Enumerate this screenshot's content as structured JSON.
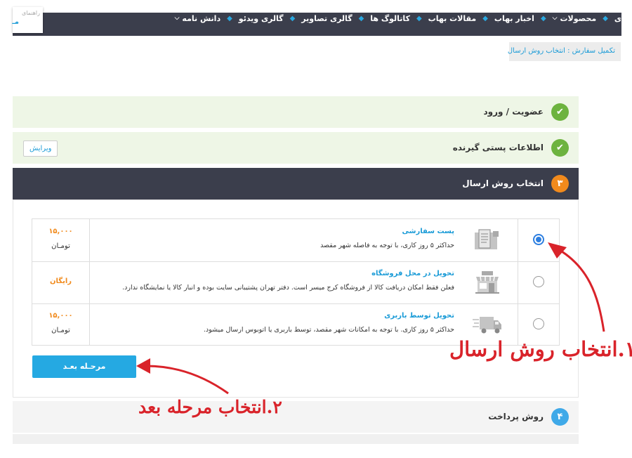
{
  "logo": {
    "line1": "راهنمای",
    "line2": "مـ"
  },
  "nav": {
    "items": [
      {
        "label": "ی",
        "dropdown": false
      },
      {
        "label": "محصولات",
        "dropdown": true
      },
      {
        "label": "اخبار بهاب",
        "dropdown": false
      },
      {
        "label": "مقالات بهاب",
        "dropdown": false
      },
      {
        "label": "کاتالوگ ها",
        "dropdown": false
      },
      {
        "label": "گالری تصاویر",
        "dropdown": false
      },
      {
        "label": "گالری ویدئو",
        "dropdown": false
      },
      {
        "label": "دانش نامه",
        "dropdown": true
      }
    ]
  },
  "breadcrumb": "تکمیل سفارش : انتخاب روش ارسال",
  "steps": {
    "s1": {
      "title": "عضویت / ورود"
    },
    "s2": {
      "title": "اطلاعات پستی گیرنده",
      "edit_label": "ویرایش"
    },
    "s3": {
      "number": "۳",
      "title": "انتخاب روش ارسال"
    },
    "s4": {
      "number": "۴",
      "title": "روش پرداخت"
    }
  },
  "shipping_options": [
    {
      "name": "پست سفارشی",
      "desc": "حداکثر ۵ روز کاری، با توجه به فاصله شهر مقصد",
      "price": "۱۵,۰۰۰",
      "currency": "تومـان",
      "selected": true,
      "icon": "mail-package-icon"
    },
    {
      "name": "تحویل در محل فروشگاه",
      "desc": "فعلن فقط امکان دریافت کالا از فروشگاه کرج میسر است. دفتر تهران پشتیبانی سایت بوده و انبار کالا یا نمایشگاه ندارد.",
      "price": "رایگان",
      "currency": "",
      "selected": false,
      "icon": "store-icon"
    },
    {
      "name": "تحویل توسط باربری",
      "desc": "حداکثر ۵ روز کاری. با توجه به امکانات شهر مقصد، توسط باربری یا اتوبوس ارسال میشود.",
      "price": "۱۵,۰۰۰",
      "currency": "تومـان",
      "selected": false,
      "icon": "truck-icon"
    }
  ],
  "next_button": "مرحـله بعـد",
  "annotations": {
    "a1": "۱.انتخاب روش ارسال",
    "a2": "۲.انتخاب مرحله بعد"
  },
  "colors": {
    "accent": "#25a9e2",
    "dark": "#3b3e4c",
    "success": "#6db33f",
    "current_step": "#f18a1c",
    "annotation": "#d9232a"
  }
}
